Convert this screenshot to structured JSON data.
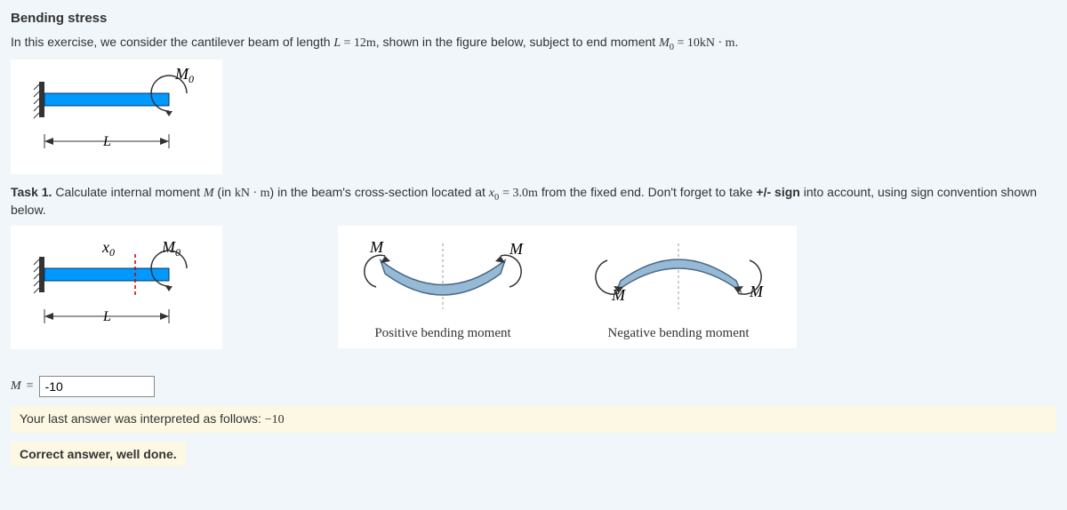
{
  "title": "Bending stress",
  "exercise": {
    "text_before": "In this exercise, we consider the cantilever beam of length ",
    "L_expr": "L = 12m",
    "text_mid": ", shown in the figure below, subject to end moment ",
    "M0_expr": "M₀ = 10kN · m",
    "text_after": "."
  },
  "figure1": {
    "moment_label": "M",
    "moment_sub": "0",
    "length_label": "L"
  },
  "task1": {
    "prefix": "Task 1.",
    "text_a": " Calculate internal moment ",
    "M_sym": "M",
    "text_b": " (in ",
    "unit": "kN · m",
    "text_c": ") in the beam's cross-section located at ",
    "x0_expr": "x₀ = 3.0m",
    "text_d": " from the fixed end. Don't forget to take ",
    "sign_text": "+/- sign",
    "text_e": " into account, using sign convention shown below."
  },
  "figure2": {
    "x0_label": "x",
    "x0_sub": "0",
    "moment_label": "M",
    "moment_sub": "0",
    "length_label": "L"
  },
  "convention": {
    "M_sym": "M",
    "positive_caption": "Positive bending moment",
    "negative_caption": "Negative bending moment"
  },
  "answer": {
    "M_sym": "M",
    "equals": " = ",
    "value": "-10"
  },
  "interpretation": {
    "prefix": "Your last answer was interpreted as follows: ",
    "value": "−10"
  },
  "feedback": "Correct answer, well done."
}
